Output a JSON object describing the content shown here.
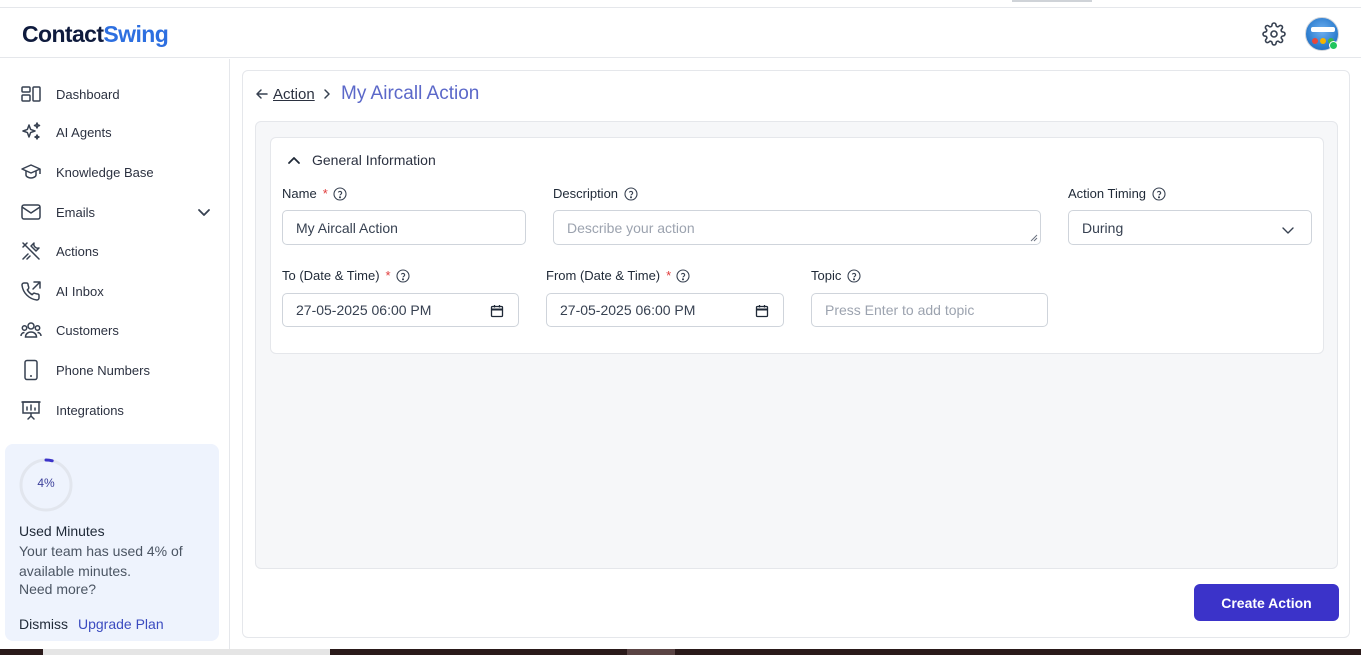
{
  "brand": {
    "part1": "Contact",
    "part2": "Swing"
  },
  "sidebar": {
    "items": [
      {
        "label": "Dashboard",
        "icon": "dashboard-icon"
      },
      {
        "label": "AI Agents",
        "icon": "sparkles-icon"
      },
      {
        "label": "Knowledge Base",
        "icon": "graduation-cap-icon"
      },
      {
        "label": "Emails",
        "icon": "mail-icon"
      },
      {
        "label": "Actions",
        "icon": "tools-icon"
      },
      {
        "label": "AI Inbox",
        "icon": "phone-outgoing-icon"
      },
      {
        "label": "Customers",
        "icon": "users-icon"
      },
      {
        "label": "Phone Numbers",
        "icon": "smartphone-icon"
      },
      {
        "label": "Integrations",
        "icon": "presentation-icon"
      }
    ]
  },
  "usage": {
    "percent_label": "4%",
    "percent": 4,
    "title": "Used Minutes",
    "description": "Your team has used 4% of available minutes.",
    "more": "Need more?",
    "dismiss": "Dismiss",
    "upgrade": "Upgrade Plan"
  },
  "breadcrumb": {
    "parent": "Action",
    "current": "My Aircall Action"
  },
  "section": {
    "title": "General Information"
  },
  "fields": {
    "name": {
      "label": "Name",
      "required": "*",
      "value": "My Aircall Action"
    },
    "description": {
      "label": "Description",
      "placeholder": "Describe your action"
    },
    "timing": {
      "label": "Action Timing",
      "value": "During"
    },
    "to": {
      "label": "To (Date & Time)",
      "required": "*",
      "value": "27-05-2025 06:00 PM"
    },
    "from": {
      "label": "From (Date & Time)",
      "required": "*",
      "value": "27-05-2025 06:00 PM"
    },
    "topic": {
      "label": "Topic",
      "placeholder": "Press Enter to add topic"
    }
  },
  "actions": {
    "create": "Create Action"
  },
  "colors": {
    "primary": "#3b33c9",
    "accent_text": "#5b68c9",
    "brand_blue": "#2d6fe0",
    "usage_bg": "#eef3fd"
  }
}
